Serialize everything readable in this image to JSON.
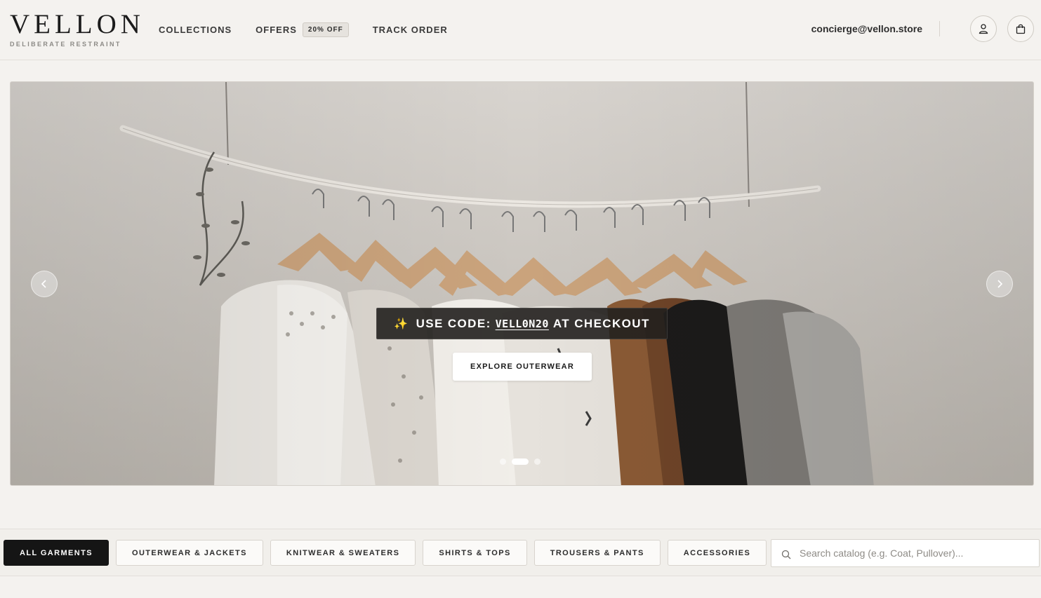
{
  "brand": {
    "name": "VELLON",
    "tagline": "DELIBERATE RESTRAINT"
  },
  "nav": {
    "collections": "COLLECTIONS",
    "offers": "OFFERS",
    "offers_badge": "20% OFF",
    "track_order": "TRACK ORDER"
  },
  "header": {
    "email": "concierge@vellon.store",
    "icons": [
      "account-icon",
      "shopping-bag-icon"
    ]
  },
  "hero": {
    "promo_prefix": "USE CODE:",
    "promo_code": "VELL0N20",
    "promo_suffix": "AT CHECKOUT",
    "promo_icon": "sparkle-icon",
    "cta_label": "EXPLORE OUTERWEAR",
    "slides_total": 3,
    "active_slide": 2,
    "prev_icon": "chevron-left-icon",
    "next_icon": "chevron-right-icon"
  },
  "categories": {
    "items": [
      {
        "label": "ALL GARMENTS",
        "active": true
      },
      {
        "label": "OUTERWEAR & JACKETS",
        "active": false
      },
      {
        "label": "KNITWEAR & SWEATERS",
        "active": false
      },
      {
        "label": "SHIRTS & TOPS",
        "active": false
      },
      {
        "label": "TROUSERS & PANTS",
        "active": false
      },
      {
        "label": "ACCESSORIES",
        "active": false
      }
    ]
  },
  "search": {
    "placeholder": "Search catalog (e.g. Coat, Pullover)...",
    "value": ""
  },
  "colors": {
    "accent": "#151515",
    "background": "#f4f2ef"
  }
}
